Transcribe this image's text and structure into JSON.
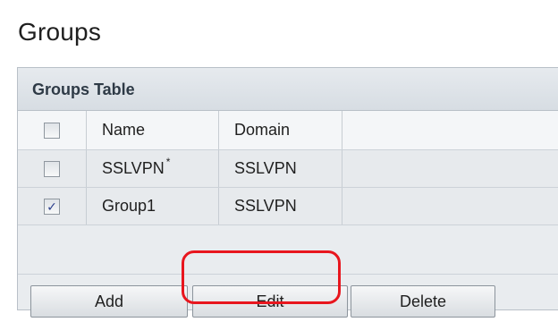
{
  "page": {
    "title": "Groups"
  },
  "groups_table": {
    "title": "Groups Table",
    "columns": [
      "Name",
      "Domain"
    ],
    "rows": [
      {
        "name": "SSLVPN",
        "marker": "*",
        "domain": "SSLVPN",
        "checked": false,
        "check_glyph": ""
      },
      {
        "name": "Group1",
        "marker": "",
        "domain": "SSLVPN",
        "checked": true,
        "check_glyph": "✓"
      }
    ],
    "header_checkbox_checked": false
  },
  "buttons": {
    "add": "Add",
    "edit": "Edit",
    "delete": "Delete"
  },
  "annotations": {
    "highlight_color": "#e8161e",
    "highlighted_button": "edit"
  }
}
